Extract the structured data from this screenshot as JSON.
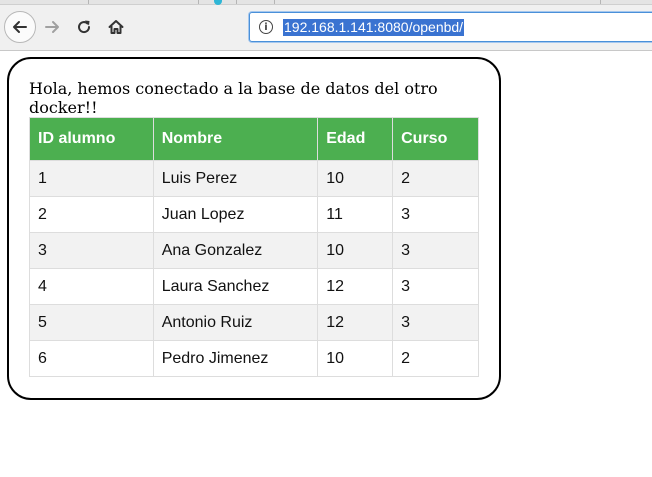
{
  "browser": {
    "url": "192.168.1.141:8080/openbd/",
    "icons": {
      "back": "back-arrow-icon",
      "forward": "forward-arrow-icon",
      "reload": "reload-icon",
      "home": "home-icon",
      "info": "info-icon"
    },
    "info_glyph": "i",
    "accent_color": "#4a90d9",
    "selection_color": "#3a73d1"
  },
  "page": {
    "greeting": "Hola, hemos conectado a la base de datos del otro docker!!",
    "table": {
      "header_color": "#4caf50",
      "stripe_color": "#f2f2f2",
      "headers": [
        "ID alumno",
        "Nombre",
        "Edad",
        "Curso"
      ],
      "rows": [
        [
          "1",
          "Luis Perez",
          "10",
          "2"
        ],
        [
          "2",
          "Juan Lopez",
          "11",
          "3"
        ],
        [
          "3",
          "Ana Gonzalez",
          "10",
          "3"
        ],
        [
          "4",
          "Laura Sanchez",
          "12",
          "3"
        ],
        [
          "5",
          "Antonio Ruiz",
          "12",
          "3"
        ],
        [
          "6",
          "Pedro Jimenez",
          "10",
          "2"
        ]
      ]
    }
  }
}
